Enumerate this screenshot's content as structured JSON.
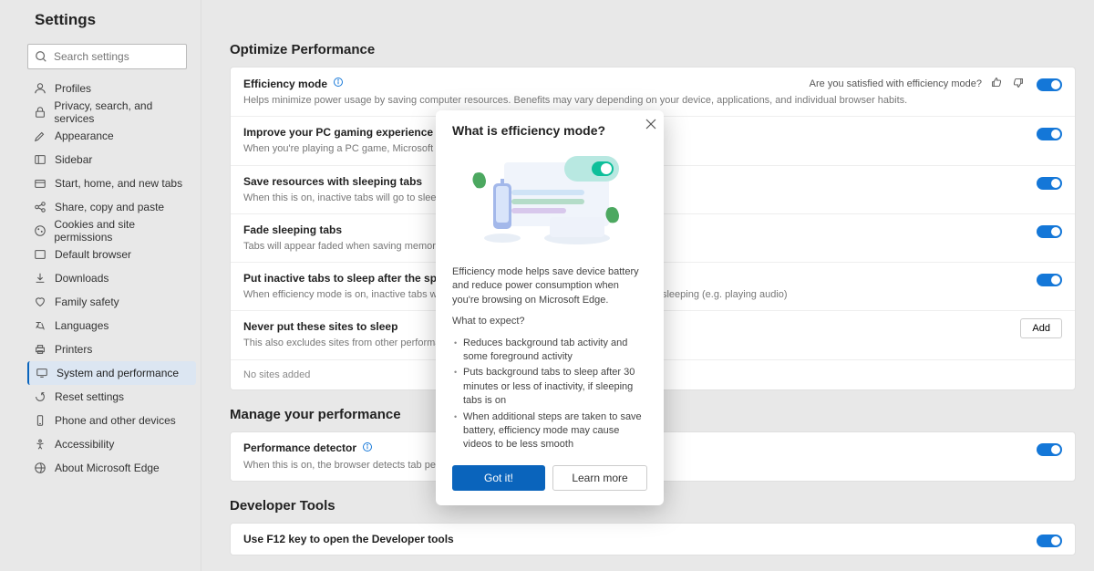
{
  "sidebar": {
    "title": "Settings",
    "search_placeholder": "Search settings",
    "items": [
      {
        "icon": "profile",
        "label": "Profiles"
      },
      {
        "icon": "lock",
        "label": "Privacy, search, and services"
      },
      {
        "icon": "paint",
        "label": "Appearance"
      },
      {
        "icon": "sidebar",
        "label": "Sidebar"
      },
      {
        "icon": "tabs",
        "label": "Start, home, and new tabs"
      },
      {
        "icon": "share",
        "label": "Share, copy and paste"
      },
      {
        "icon": "cookie",
        "label": "Cookies and site permissions"
      },
      {
        "icon": "browser",
        "label": "Default browser"
      },
      {
        "icon": "download",
        "label": "Downloads"
      },
      {
        "icon": "family",
        "label": "Family safety"
      },
      {
        "icon": "lang",
        "label": "Languages"
      },
      {
        "icon": "printer",
        "label": "Printers"
      },
      {
        "icon": "system",
        "label": "System and performance",
        "active": true
      },
      {
        "icon": "reset",
        "label": "Reset settings"
      },
      {
        "icon": "phone",
        "label": "Phone and other devices"
      },
      {
        "icon": "access",
        "label": "Accessibility"
      },
      {
        "icon": "about",
        "label": "About Microsoft Edge"
      }
    ]
  },
  "optimize": {
    "heading": "Optimize Performance",
    "rows": [
      {
        "title": "Efficiency mode",
        "desc": "Helps minimize power usage by saving computer resources. Benefits may vary depending on your device, applications, and individual browser habits.",
        "info": true,
        "feedback": "Are you satisfied with efficiency mode?"
      },
      {
        "title": "Improve your PC gaming experience with efficiency mode",
        "desc": "When you're playing a PC game, Microsoft Edge reduces its c"
      },
      {
        "title": "Save resources with sleeping tabs",
        "desc": "When this is on, inactive tabs will go to sleep after a specified"
      },
      {
        "title": "Fade sleeping tabs",
        "desc": "Tabs will appear faded when saving memory and CPU to impr"
      },
      {
        "title": "Put inactive tabs to sleep after the specified amoun",
        "desc": "When efficiency mode is on, inactive tabs will be put to sleep activities that prevent a site from sleeping (e.g. playing audio)"
      },
      {
        "title": "Never put these sites to sleep",
        "desc": "This also excludes sites from other performance optimizations",
        "add": "Add"
      }
    ],
    "no_sites": "No sites added"
  },
  "manage": {
    "heading": "Manage your performance",
    "rows": [
      {
        "title": "Performance detector",
        "desc": "When this is on, the browser detects tab performance issues a",
        "info": true
      }
    ]
  },
  "dev": {
    "heading": "Developer Tools",
    "rows": [
      {
        "title": "Use F12 key to open the Developer tools"
      }
    ]
  },
  "modal": {
    "title": "What is efficiency mode?",
    "para": "Efficiency mode helps save device battery and reduce power consumption when you're browsing on Microsoft Edge.",
    "expect": "What to expect?",
    "bullets": [
      "Reduces background tab activity and some foreground activity",
      "Puts background tabs to sleep after 30 minutes or less of inactivity, if sleeping tabs is on",
      "When additional steps are taken to save battery, efficiency mode may cause videos to be less smooth"
    ],
    "got_it": "Got it!",
    "learn_more": "Learn more"
  }
}
